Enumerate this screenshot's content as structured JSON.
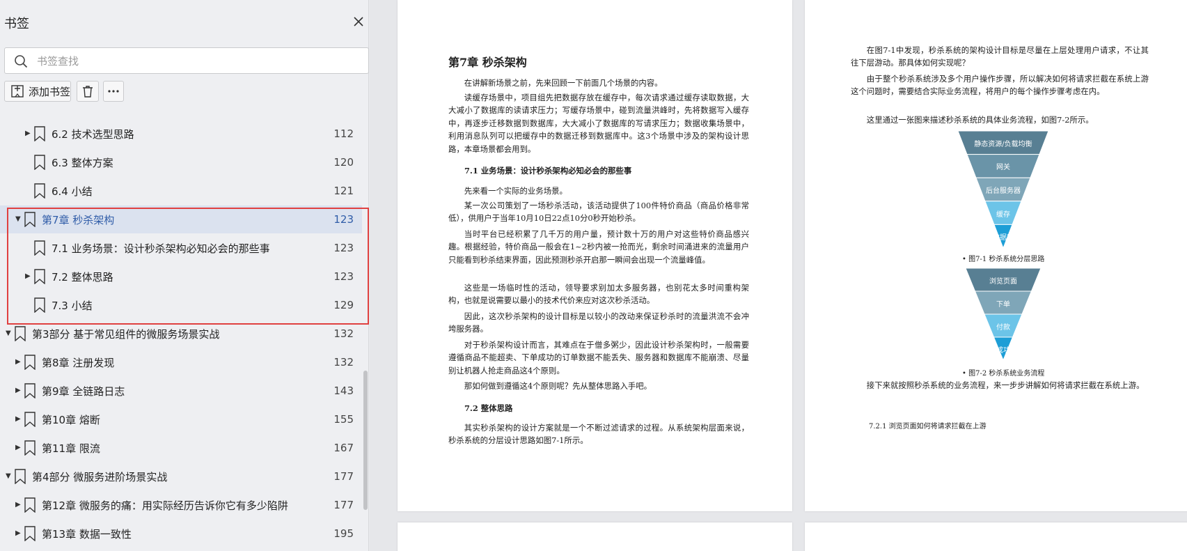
{
  "sidebar": {
    "title": "书签",
    "search_placeholder": "书签查找",
    "add_label": "添加书签",
    "bookmarks": [
      {
        "label": "6.2 技术选型思路",
        "page": "112",
        "level": 2,
        "toggle": "▶"
      },
      {
        "label": "6.3 整体方案",
        "page": "120",
        "level": 2,
        "toggle": ""
      },
      {
        "label": "6.4 小结",
        "page": "121",
        "level": 2,
        "toggle": ""
      },
      {
        "label": "第7章 秒杀架构",
        "page": "123",
        "level": 1,
        "toggle": "▼",
        "selected": true
      },
      {
        "label": "7.1 业务场景：设计秒杀架构必知必会的那些事",
        "page": "123",
        "level": 2,
        "toggle": ""
      },
      {
        "label": "7.2 整体思路",
        "page": "123",
        "level": 2,
        "toggle": "▶"
      },
      {
        "label": "7.3 小结",
        "page": "129",
        "level": 2,
        "toggle": ""
      },
      {
        "label": "第3部分 基于常见组件的微服务场景实战",
        "page": "132",
        "level": 0,
        "toggle": "▼"
      },
      {
        "label": "第8章 注册发现",
        "page": "132",
        "level": 1,
        "toggle": "▶"
      },
      {
        "label": "第9章 全链路日志",
        "page": "143",
        "level": 1,
        "toggle": "▶"
      },
      {
        "label": "第10章 熔断",
        "page": "155",
        "level": 1,
        "toggle": "▶"
      },
      {
        "label": "第11章 限流",
        "page": "167",
        "level": 1,
        "toggle": "▶"
      },
      {
        "label": "第4部分 微服务进阶场景实战",
        "page": "177",
        "level": 0,
        "toggle": "▼"
      },
      {
        "label": "第12章 微服务的痛：用实际经历告诉你它有多少陷阱",
        "page": "177",
        "level": 1,
        "toggle": "▶"
      },
      {
        "label": "第13章 数据一致性",
        "page": "195",
        "level": 1,
        "toggle": "▶"
      }
    ]
  },
  "page1": {
    "title": "第7章  秒杀架构",
    "p1": "在讲解新场景之前，先来回顾一下前面几个场景的内容。",
    "p2": "读缓存场景中，项目组先把数据存放在缓存中，每次请求通过缓存读取数据，大大减小了数据库的读请求压力；写缓存场景中，碰到流量洪峰时，先将数据写入缓存中，再逐步迁移数据到数据库，大大减小了数据库的写请求压力；数据收集场景中，利用消息队列可以把缓存中的数据迁移到数据库中。这3个场景中涉及的架构设计思路，本章场景都会用到。",
    "s1": "7.1  业务场景：设计秒杀架构必知必会的那些事",
    "p3": "先来看一个实际的业务场景。",
    "p4": "某一次公司策划了一场秒杀活动，该活动提供了100件特价商品（商品价格非常低），供用户于当年10月10日22点10分0秒开始秒杀。",
    "p5": "当时平台已经积累了几千万的用户量，预计数十万的用户对这些特价商品感兴趣。根据经验，特价商品一般会在1~2秒内被一抢而光，剩余时间涌进来的流量用户只能看到秒杀结束界面，因此预测秒杀开启那一瞬间会出现一个流量峰值。",
    "p6": "这些是一场临时性的活动，领导要求别加太多服务器，也别花太多时间重构架构，也就是说需要以最小的技术代价来应对这次秒杀活动。",
    "p7": "因此，这次秒杀架构的设计目标是以较小的改动来保证秒杀时的流量洪流不会冲垮服务器。",
    "p8": "对于秒杀架构设计而言，其难点在于僧多粥少，因此设计秒杀架构时，一般需要遵循商品不能超卖、下单成功的订单数据不能丢失、服务器和数据库不能崩溃、尽量别让机器人抢走商品这4个原则。",
    "p9": "那如何做到遵循这4个原则呢？先从整体思路入手吧。",
    "s2": "7.2  整体思路",
    "p10": "其实秒杀架构的设计方案就是一个不断过滤请求的过程。从系统架构层面来说，秒杀系统的分层设计思路如图7-1所示。"
  },
  "page2": {
    "p1": "在图7-1中发现，秒杀系统的架构设计目标是尽量在上层处理用户请求，不让其往下层游动。那具体如何实现呢？",
    "p2": "由于整个秒杀系统涉及多个用户操作步骤，所以解决如何将请求拦截在系统上游这个问题时，需要结合实际业务流程，将用户的每个操作步骤考虑在内。",
    "p3": "这里通过一张图来描述秒杀系统的具体业务流程，如图7-2所示。",
    "funnel1": [
      "静态资源/负载均衡",
      "网关",
      "后台服务器",
      "缓存",
      "数据库"
    ],
    "caption1": "• 图7-1  秒杀系统分层思路",
    "funnel2": [
      "浏览页面",
      "下单",
      "付款",
      "成功"
    ],
    "caption2": "• 图7-2  秒杀系统业务流程",
    "p4": "接下来就按照秒杀系统的业务流程，来一步步讲解如何将请求拦截在系统上游。",
    "s1": "7.2.1  浏览页面如何将请求拦截在上游"
  },
  "colors": {
    "highlight": "#e04040",
    "selected_bg": "#dbe2ef",
    "selected_text": "#2f5ca8",
    "funnel": [
      "#587f93",
      "#6a94a8",
      "#7fa6b8",
      "#6cc4e8",
      "#1d9ed6"
    ],
    "funnel2": [
      "#587f93",
      "#7fa6b8",
      "#6cc4e8",
      "#1d9ed6"
    ]
  }
}
